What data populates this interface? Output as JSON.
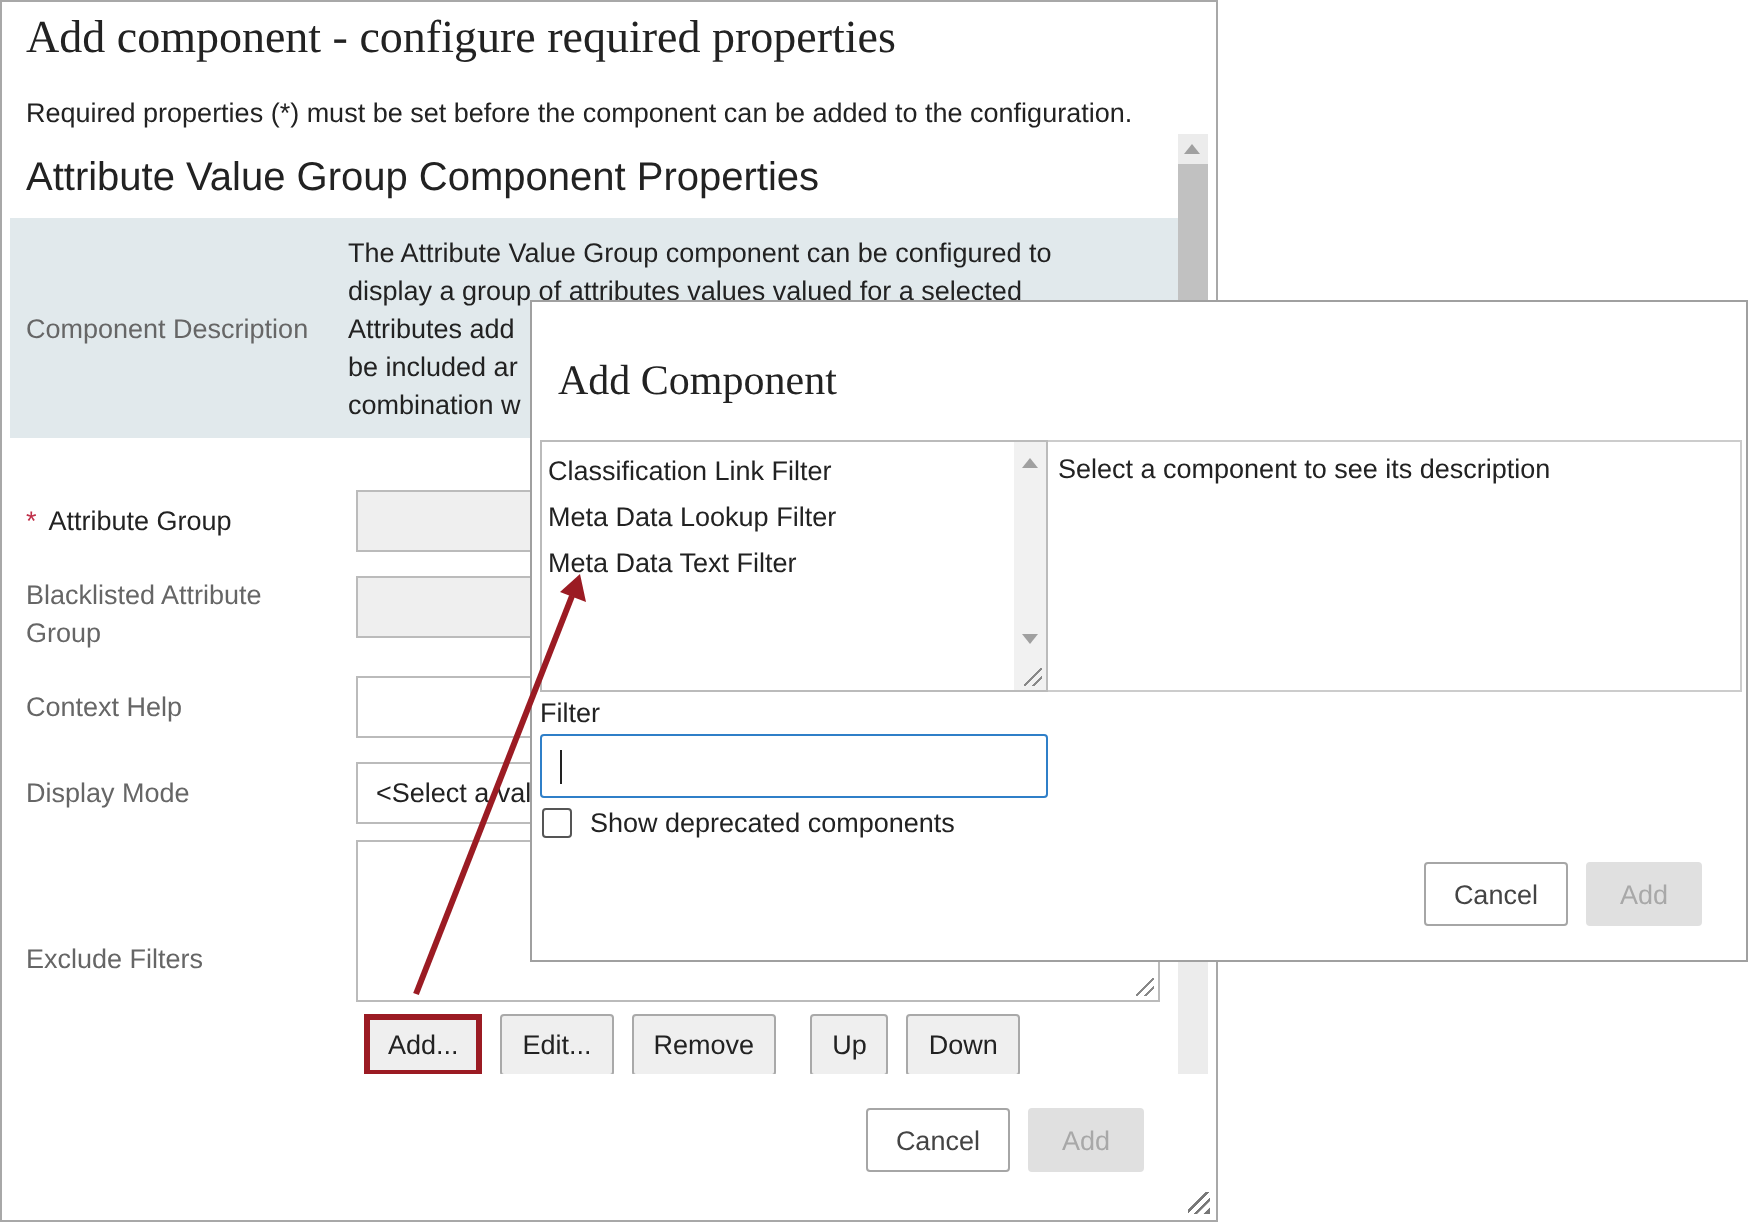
{
  "dialog": {
    "title": "Add component - configure required properties",
    "note": "Required properties (*) must be set before the component can be added to the configuration.",
    "section_title": "Attribute Value Group Component Properties",
    "description": {
      "label": "Component Description",
      "lines": [
        "The Attribute Value Group component can be configured to",
        "display a group of attributes values valued for a selected",
        "Attributes add",
        "be included ar",
        "combination w"
      ]
    },
    "fields": [
      {
        "label": "Attribute Group",
        "marker": "*",
        "kind": "readonly"
      },
      {
        "label": "Blacklisted Attribute Group",
        "kind": "readonly"
      },
      {
        "label": "Context Help",
        "kind": "text"
      },
      {
        "label": "Display Mode",
        "kind": "select",
        "value": "<Select a val"
      },
      {
        "label": "Exclude Filters",
        "kind": "list"
      }
    ],
    "list_buttons": [
      {
        "label": "Add...",
        "highlighted": true
      },
      {
        "label": "Edit...",
        "highlighted": false
      },
      {
        "label": "Remove",
        "highlighted": false
      },
      {
        "label": "Up",
        "highlighted": false
      },
      {
        "label": "Down",
        "highlighted": false
      }
    ],
    "buttons": [
      {
        "label": "Cancel",
        "disabled": false
      },
      {
        "label": "Add",
        "disabled": true
      }
    ]
  },
  "add_component": {
    "title": "Add Component",
    "items": [
      {
        "label": "Classification Link Filter",
        "selected": false
      },
      {
        "label": "Meta Data Lookup Filter",
        "selected": false
      },
      {
        "label": "Meta Data Text Filter",
        "selected": false
      }
    ],
    "description": "Select a component to see its description",
    "filter": {
      "label": "Filter",
      "focused": true
    },
    "deprecated": {
      "label": "Show deprecated components",
      "checked": false
    },
    "buttons": [
      {
        "label": "Cancel",
        "disabled": false
      },
      {
        "label": "Add",
        "disabled": true
      }
    ]
  }
}
